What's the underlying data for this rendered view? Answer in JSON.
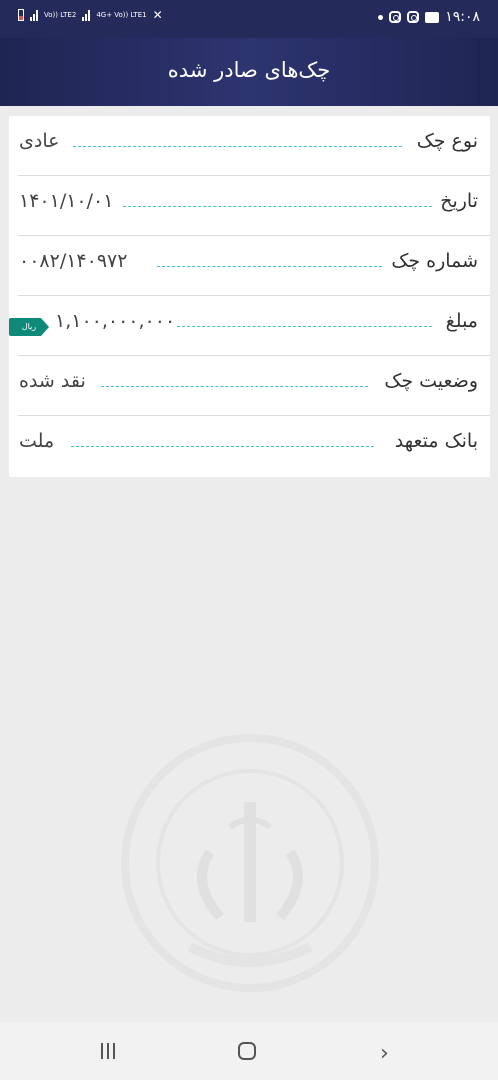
{
  "status_bar": {
    "time": "۱۹:۰۸",
    "sim1_label": "Vo)) LTE2",
    "sim2_label": "4G+ Vo)) LTE1"
  },
  "header": {
    "title": "چک‌های صادر شده"
  },
  "details": [
    {
      "label": "نوع چک",
      "value": "عادی"
    },
    {
      "label": "تاریخ",
      "value": "۱۴۰۱/۱۰/۰۱"
    },
    {
      "label": "شماره چک",
      "value": "۰۰۸۲/۱۴۰۹۷۲"
    },
    {
      "label": "مبلغ",
      "value": "۱,۱۰۰,۰۰۰,۰۰۰",
      "unit": "ریال"
    },
    {
      "label": "وضعیت چک",
      "value": "نقد شده"
    },
    {
      "label": "بانک متعهد",
      "value": "ملت"
    }
  ],
  "colors": {
    "header": "#242a5a",
    "dash": "#3bc4d0",
    "badge": "#0e8a78"
  },
  "icons": [
    "instagram-icon",
    "chat-icon",
    "signal-icon",
    "battery-icon",
    "mute-icon",
    "recent-apps-icon",
    "home-icon",
    "back-icon"
  ]
}
